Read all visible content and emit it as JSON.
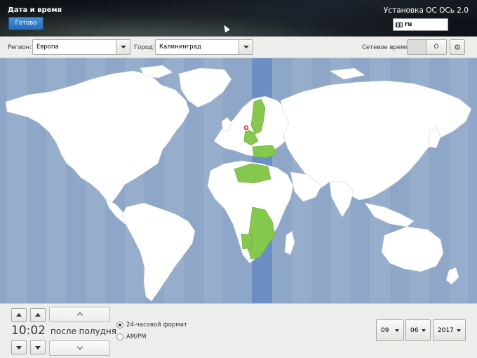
{
  "header": {
    "page_title": "Дата и время",
    "done_label": "Готово",
    "product_title": "Установка ОС ОСь 2.0",
    "keyboard_layout": "ru"
  },
  "toolbar": {
    "region_label": "Регион:",
    "region_value": "Европа",
    "city_label": "Город:",
    "city_value": "Калининград",
    "ntp_label": "Сетевое время",
    "ntp_state": "O"
  },
  "map": {
    "ocean_color": "#8ea6c7",
    "land_color": "#ffffff",
    "highlight_color": "#86c74d",
    "selected_band_color": "#6b8fc4",
    "marker_icon": "location-pin-icon"
  },
  "time": {
    "value": "10:02",
    "ampm": "после полудня",
    "format_24h_label": "24-часовой формат",
    "format_ampm_label": "AM/PM",
    "format_24h_checked": true
  },
  "date": {
    "day": "09",
    "month": "06",
    "year": "2017"
  }
}
